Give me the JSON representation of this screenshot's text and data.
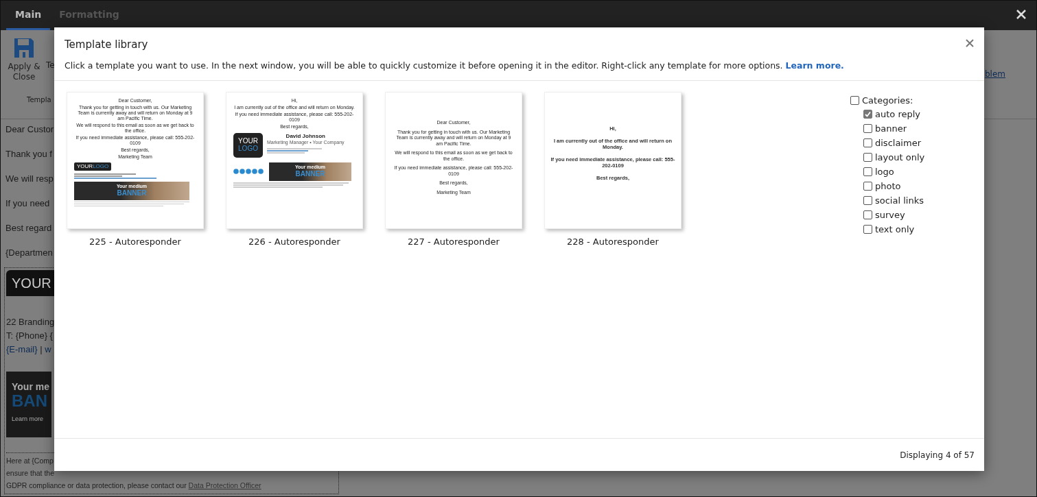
{
  "app": {
    "tabs": [
      {
        "label": "Main",
        "selected": true
      },
      {
        "label": "Formatting",
        "selected": false
      }
    ],
    "ribbon": {
      "apply_label": "Apply &\nClose",
      "cut_button": "Te",
      "group_label": "Templa",
      "link": "blem"
    },
    "body_lines": [
      "Dear Custor",
      "Thank you f",
      "We will resp",
      "If you need",
      "Best regard",
      "{Departmen"
    ],
    "signature": {
      "logo": "YOUR",
      "address": "22 Branding",
      "phone": "T: {Phone} {",
      "email": "{E-mail}",
      "separator": " | ",
      "web": "w",
      "banner": {
        "line_1": "Your me",
        "line_2": "BAN",
        "button": "Learn more"
      },
      "disclaimer": [
        "Here at {Comp",
        "ensure that the"
      ],
      "disclaimer_last": "GDPR compliance or data protection, please contact our ",
      "disclaimer_link": "Data Protection Officer"
    }
  },
  "dialog": {
    "title": "Template library",
    "description": "Click a template you want to use. In the next window, you will be able to quickly customize it before opening it in the editor. Right-click any template for more options. ",
    "learn_more": "Learn more.",
    "templates": [
      {
        "name": "225 - Autoresponder",
        "kind": "compact",
        "blocks": [
          {
            "kind": "text",
            "text": "Dear Customer,"
          },
          {
            "kind": "text",
            "text": "Thank you for getting in touch with us. Our Marketing Team is currently away and will return on Monday at 9 am Pacific Time."
          },
          {
            "kind": "text",
            "text": "We will respond to this email as soon as we get back to the office."
          },
          {
            "kind": "text",
            "text": "If you need immediate assistance, please call: 555-202-0109"
          },
          {
            "kind": "text",
            "text": "Best regards,"
          },
          {
            "kind": "text",
            "text": "Marketing Team"
          },
          {
            "kind": "logo",
            "parts": [
              "YOUR",
              "LOGO"
            ]
          },
          {
            "kind": "contact_lines"
          },
          {
            "kind": "banner",
            "parts": [
              "Your medium",
              "BANNER"
            ]
          },
          {
            "kind": "fine_print"
          }
        ]
      },
      {
        "name": "226 - Autoresponder",
        "kind": "compact",
        "blocks": [
          {
            "kind": "text",
            "text": "Hi,"
          },
          {
            "kind": "text",
            "text": "I am currently out of the office and will return on Monday."
          },
          {
            "kind": "text",
            "text": "If you need immediate assistance, please call: 555-202-0109"
          },
          {
            "kind": "text",
            "text": "Best regards,"
          },
          {
            "kind": "card",
            "parts": [
              "YOUR",
              "LOGO"
            ],
            "name": "David Johnson",
            "role": "Marketing Manager • Your Company"
          },
          {
            "kind": "social_banner",
            "parts": [
              "Your medium",
              "BANNER"
            ]
          },
          {
            "kind": "fine_print"
          }
        ]
      },
      {
        "name": "227 - Autoresponder",
        "kind": "plain",
        "blocks": [
          {
            "kind": "text",
            "text": "Dear Customer,"
          },
          {
            "kind": "text",
            "text": "Thank you for getting in touch with us. Our Marketing Team is currently away and will return on Monday at 9 am Pacific Time."
          },
          {
            "kind": "text",
            "text": "We will respond to this email as soon as we get back to the office."
          },
          {
            "kind": "text",
            "text": "If you need immediate assistance, please call: 555-202-0109"
          },
          {
            "kind": "text",
            "text": "Best regards,"
          },
          {
            "kind": "text",
            "text": "Marketing Team"
          }
        ]
      },
      {
        "name": "228 - Autoresponder",
        "kind": "large",
        "blocks": [
          {
            "kind": "text",
            "text": "Hi,"
          },
          {
            "kind": "text",
            "text": "I am currently out of the office and will return on Monday."
          },
          {
            "kind": "text",
            "text": "If you need immediate assistance, please call: 555-202-0109"
          },
          {
            "kind": "text",
            "text": "Best regards,"
          }
        ]
      }
    ],
    "categories": {
      "label": "Categories:",
      "checked": false,
      "items": [
        {
          "label": "auto reply",
          "checked": true
        },
        {
          "label": "banner",
          "checked": false
        },
        {
          "label": "disclaimer",
          "checked": false
        },
        {
          "label": "layout only",
          "checked": false
        },
        {
          "label": "logo",
          "checked": false
        },
        {
          "label": "photo",
          "checked": false
        },
        {
          "label": "social links",
          "checked": false
        },
        {
          "label": "survey",
          "checked": false
        },
        {
          "label": "text only",
          "checked": false
        }
      ]
    },
    "status": "Displaying 4 of 57"
  }
}
